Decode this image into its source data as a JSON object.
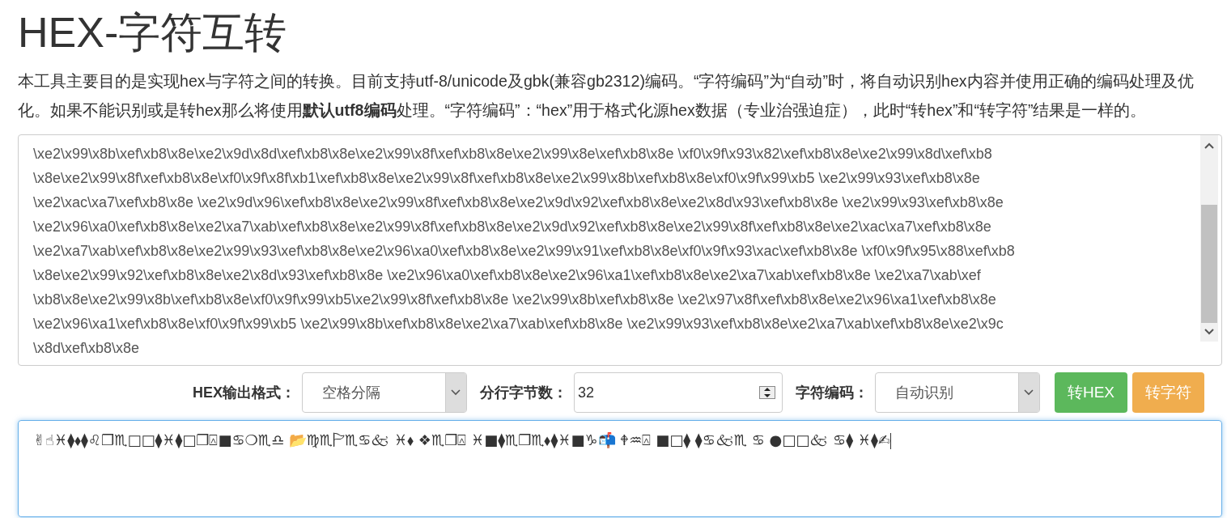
{
  "title": "HEX-字符互转",
  "description": "本工具主要目的是实现hex与字符之间的转换。目前支持utf-8/unicode及gbk(兼容gb2312)编码。“字符编码”为“自动”时，将自动识别hex内容并使用正确的编码处理及优化。如果不能识别或是转hex那么将使用**默认utf8编码**处理。“字符编码”：“hex”用于格式化源hex数据（专业治强迫症），此时“转hex”和“转字符”结果是一样的。",
  "hex_input": {
    "lines": [
      "\\xe2\\x99\\x8b\\xef\\xb8\\x8e\\xe2\\x9d\\x8d\\xef\\xb8\\x8e\\xe2\\x99\\x8f\\xef\\xb8\\x8e\\xe2\\x99\\x8e\\xef\\xb8\\x8e \\xf0\\x9f\\x93\\x82\\xef\\xb8\\x8e\\xe2\\x99\\x8d\\xef\\xb8",
      "\\x8e\\xe2\\x99\\x8f\\xef\\xb8\\x8e\\xf0\\x9f\\x8f\\xb1\\xef\\xb8\\x8e\\xe2\\x99\\x8f\\xef\\xb8\\x8e\\xe2\\x99\\x8b\\xef\\xb8\\x8e\\xf0\\x9f\\x99\\xb5 \\xe2\\x99\\x93\\xef\\xb8\\x8e",
      "\\xe2\\xac\\xa7\\xef\\xb8\\x8e \\xe2\\x9d\\x96\\xef\\xb8\\x8e\\xe2\\x99\\x8f\\xef\\xb8\\x8e\\xe2\\x9d\\x92\\xef\\xb8\\x8e\\xe2\\x8d\\x93\\xef\\xb8\\x8e \\xe2\\x99\\x93\\xef\\xb8\\x8e",
      "\\xe2\\x96\\xa0\\xef\\xb8\\x8e\\xe2\\xa7\\xab\\xef\\xb8\\x8e\\xe2\\x99\\x8f\\xef\\xb8\\x8e\\xe2\\x9d\\x92\\xef\\xb8\\x8e\\xe2\\x99\\x8f\\xef\\xb8\\x8e\\xe2\\xac\\xa7\\xef\\xb8\\x8e",
      "\\xe2\\xa7\\xab\\xef\\xb8\\x8e\\xe2\\x99\\x93\\xef\\xb8\\x8e\\xe2\\x96\\xa0\\xef\\xb8\\x8e\\xe2\\x99\\x91\\xef\\xb8\\x8e\\xf0\\x9f\\x93\\xac\\xef\\xb8\\x8e \\xf0\\x9f\\x95\\x88\\xef\\xb8",
      "\\x8e\\xe2\\x99\\x92\\xef\\xb8\\x8e\\xe2\\x8d\\x93\\xef\\xb8\\x8e \\xe2\\x96\\xa0\\xef\\xb8\\x8e\\xe2\\x96\\xa1\\xef\\xb8\\x8e\\xe2\\xa7\\xab\\xef\\xb8\\x8e \\xe2\\xa7\\xab\\xef",
      "\\xb8\\x8e\\xe2\\x99\\x8b\\xef\\xb8\\x8e\\xf0\\x9f\\x99\\xb5\\xe2\\x99\\x8f\\xef\\xb8\\x8e \\xe2\\x99\\x8b\\xef\\xb8\\x8e \\xe2\\x97\\x8f\\xef\\xb8\\x8e\\xe2\\x96\\xa1\\xef\\xb8\\x8e",
      "\\xe2\\x96\\xa1\\xef\\xb8\\x8e\\xf0\\x9f\\x99\\xb5 \\xe2\\x99\\x8b\\xef\\xb8\\x8e\\xe2\\xa7\\xab\\xef\\xb8\\x8e \\xe2\\x99\\x93\\xef\\xb8\\x8e\\xe2\\xa7\\xab\\xef\\xb8\\x8e\\xe2\\x9c",
      "\\x8d\\xef\\xb8\\x8e"
    ]
  },
  "controls": [
    {
      "kind": "select",
      "label": "HEX输出格式：",
      "value": "空格分隔"
    },
    {
      "kind": "number",
      "label": "分行字节数：",
      "value": "32"
    },
    {
      "kind": "select",
      "label": "字符编码：",
      "value": "自动识别"
    }
  ],
  "buttons": [
    {
      "label": "转HEX",
      "color": "#5cb85c"
    },
    {
      "label": "转字符",
      "color": "#f0ad4e"
    }
  ],
  "text_output": {
    "value": "✌☝♓⧫⬧⧫♌❒♏□□⧫♓⧫□❒⍓■♋❍♏♎ 📂♍♏🏱♏♋🙵 ♓⬧ ❖♏❒⍓ ♓■⧫♏❒♏⬧⧫♓■♑📬 🕈♒⍓ ■□⧫ ⧫♋🙵♏ ♋ ●□□🙵 ♋⧫ ♓⧫✍",
    "focused": true
  }
}
